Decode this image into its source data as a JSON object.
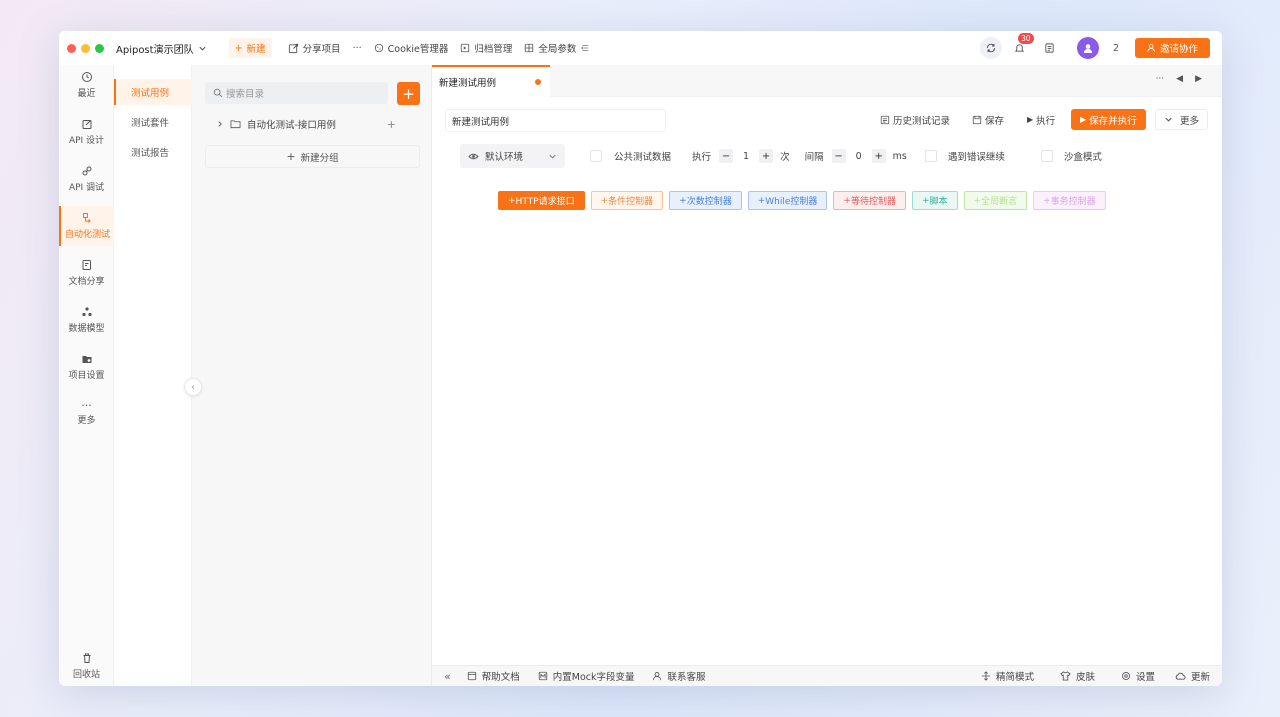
{
  "topbar": {
    "team_name": "Apipost演示团队",
    "new_label": "新建",
    "share_label": "分享项目",
    "more_label": "···",
    "cookie_label": "Cookie管理器",
    "archive_label": "归档管理",
    "global_params_label": "全局参数",
    "notification_count": "30",
    "online_count": "2",
    "invite_label": "邀请协作"
  },
  "leftnav": {
    "items": [
      {
        "label": "最近"
      },
      {
        "label": "API 设计"
      },
      {
        "label": "API 调试"
      },
      {
        "label": "自动化测试"
      },
      {
        "label": "文档分享"
      },
      {
        "label": "数据模型"
      },
      {
        "label": "项目设置"
      },
      {
        "label": "更多"
      }
    ],
    "trash_label": "回收站"
  },
  "subnav": {
    "items": [
      {
        "label": "测试用例"
      },
      {
        "label": "测试套件"
      },
      {
        "label": "测试报告"
      }
    ]
  },
  "tree": {
    "search_placeholder": "搜索目录",
    "folder_label": "自动化测试-接口用例",
    "new_group_label": "新建分组"
  },
  "tab": {
    "title": "新建测试用例"
  },
  "editor": {
    "name_value": "新建测试用例",
    "history_label": "历史测试记录",
    "save_label": "保存",
    "run_label": "执行",
    "save_run_label": "保存并执行",
    "more_label": "更多",
    "env_label": "默认环境",
    "public_data_label": "公共测试数据",
    "exec_label": "执行",
    "exec_count": "1",
    "exec_unit": "次",
    "interval_label": "间隔",
    "interval_value": "0",
    "interval_unit": "ms",
    "continue_on_error_label": "遇到错误继续",
    "sandbox_label": "沙盒模式"
  },
  "controllers": [
    {
      "label": "HTTP请求接口",
      "color": "#f97316"
    },
    {
      "label": "条件控制器",
      "color": "#f6a15b"
    },
    {
      "label": "次数控制器",
      "color": "#5b8fe0"
    },
    {
      "label": "While控制器",
      "color": "#5b8fe0"
    },
    {
      "label": "等待控制器",
      "color": "#e86a6a"
    },
    {
      "label": "脚本",
      "color": "#3fb9a6"
    },
    {
      "label": "全局断言",
      "color": "#9bd17a"
    },
    {
      "label": "事务控制器",
      "color": "#dca0e6"
    }
  ],
  "statusbar": {
    "help_label": "帮助文档",
    "mock_label": "内置Mock字段变量",
    "support_label": "联系客服",
    "simple_mode_label": "精简模式",
    "skin_label": "皮肤",
    "settings_label": "设置",
    "update_label": "更新"
  },
  "colors": {
    "accent": "#f97316",
    "traffic_red": "#ff5f57",
    "traffic_yellow": "#febc2e",
    "traffic_green": "#28c840"
  }
}
